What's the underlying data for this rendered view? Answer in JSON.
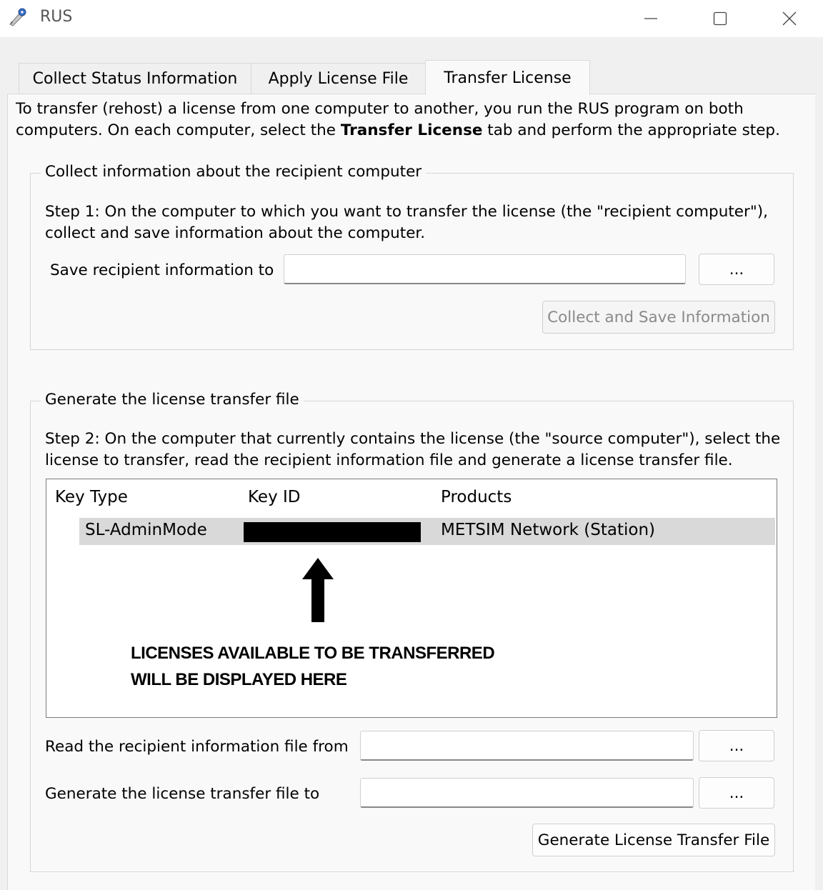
{
  "window": {
    "title": "RUS",
    "icon": "key-pen-icon"
  },
  "window_controls": {
    "minimize_icon": "minimize-icon",
    "maximize_icon": "maximize-icon",
    "close_icon": "close-icon"
  },
  "tabs": [
    {
      "label": "Collect Status Information",
      "active": false
    },
    {
      "label": "Apply License File",
      "active": false
    },
    {
      "label": "Transfer License",
      "active": true
    }
  ],
  "intro": {
    "part1": "To transfer (rehost) a license from one computer to another, you run the RUS program on both computers. On each computer, select the ",
    "bold": "Transfer License",
    "part2": " tab and perform the appropriate step."
  },
  "collect_group": {
    "title": "Collect information about the recipient computer",
    "step_text": "Step 1: On the computer to which you want to transfer the license (the \"recipient computer\"), collect and save information about the computer.",
    "save_label": "Save recipient information to",
    "save_value": "",
    "browse_label": "...",
    "collect_button": "Collect and Save Information",
    "collect_enabled": false
  },
  "generate_group": {
    "title": "Generate the license transfer file",
    "step_text": "Step 2: On the computer that currently contains the license (the \"source computer\"), select the license to transfer, read the recipient information file and generate a license transfer file.",
    "table": {
      "columns": [
        "Key Type",
        "Key ID",
        "Products"
      ],
      "rows": [
        {
          "key_type": "SL-AdminMode",
          "key_id": "",
          "products": "METSIM Network (Station)",
          "selected": true
        }
      ]
    },
    "annotation": {
      "line1": "LICENSES AVAILABLE TO BE TRANSFERRED",
      "line2": "WILL BE DISPLAYED HERE"
    },
    "read_label": "Read the recipient information file from",
    "read_value": "",
    "generate_to_label": "Generate the license transfer file to",
    "generate_to_value": "",
    "browse_label": "...",
    "generate_button": "Generate License Transfer File"
  }
}
